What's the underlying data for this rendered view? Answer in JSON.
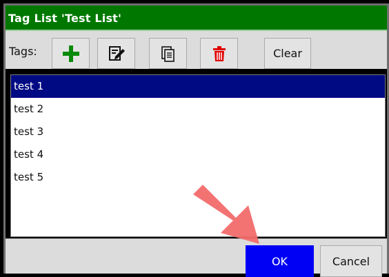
{
  "dialog": {
    "title": "Tag List 'Test List'"
  },
  "toolbar": {
    "tags_label": "Tags:",
    "clear_label": "Clear",
    "icons": {
      "add": "plus-icon",
      "edit": "edit-icon",
      "copy": "copy-icon",
      "delete": "trash-icon"
    }
  },
  "list": {
    "items": [
      "test 1",
      "test 2",
      "test 3",
      "test 4",
      "test 5"
    ],
    "selected": "test 1"
  },
  "footer": {
    "ok_label": "OK",
    "cancel_label": "Cancel"
  },
  "colors": {
    "titlebar": "#007800",
    "selection": "#000a83",
    "ok_button": "#0000f5",
    "add_icon": "#0a8a0a",
    "delete_icon": "#e00000",
    "annotation_arrow": "#f26b6b"
  }
}
